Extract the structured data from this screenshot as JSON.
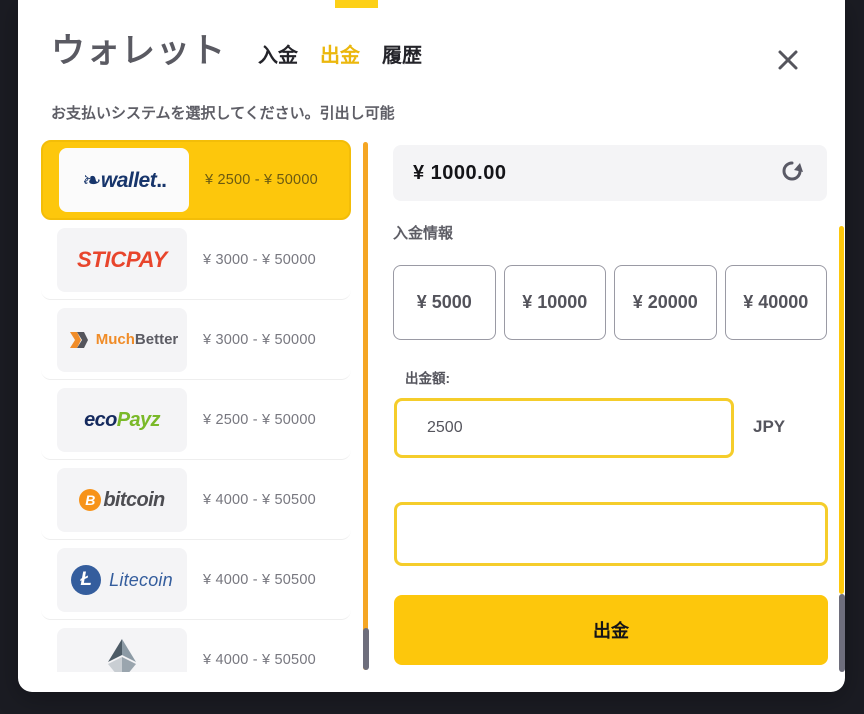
{
  "window": {
    "title": "ウォレット",
    "close_icon": "close-icon"
  },
  "tabs": [
    {
      "label": "入金",
      "active": false
    },
    {
      "label": "出金",
      "active": true
    },
    {
      "label": "履歴",
      "active": false
    }
  ],
  "subtitle": "お支払いシステムを選択してください。引出し可能",
  "payment_methods": [
    {
      "name": "iWallet",
      "logo": "iwallet-logo",
      "range": "¥ 2500 - ¥ 50000",
      "selected": true
    },
    {
      "name": "STICPAY",
      "logo": "sticpay-logo",
      "range": "¥ 3000 - ¥ 50000",
      "selected": false
    },
    {
      "name": "MuchBetter",
      "logo": "muchbetter-logo",
      "range": "¥ 3000 - ¥ 50000",
      "selected": false
    },
    {
      "name": "ecoPayz",
      "logo": "ecopayz-logo",
      "range": "¥ 2500 - ¥ 50000",
      "selected": false
    },
    {
      "name": "bitcoin",
      "logo": "bitcoin-logo",
      "range": "¥ 4000 - ¥ 50500",
      "selected": false
    },
    {
      "name": "Litecoin",
      "logo": "litecoin-logo",
      "range": "¥ 4000 - ¥ 50500",
      "selected": false
    },
    {
      "name": "Ethereum",
      "logo": "ethereum-logo",
      "range": "¥ 4000 - ¥ 50500",
      "selected": false
    }
  ],
  "balance": {
    "amount": "¥ 1000.00",
    "refresh_icon": "refresh-icon"
  },
  "deposit_info_label": "入金情報",
  "quick_amounts": [
    "¥ 5000",
    "¥ 10000",
    "¥ 20000",
    "¥ 40000"
  ],
  "amount_field": {
    "label": "出金額:",
    "value": "2500",
    "placeholder": "",
    "currency": "JPY"
  },
  "extra_field": {
    "value": "",
    "placeholder": ""
  },
  "submit": {
    "label": "出金"
  },
  "colors": {
    "accent_yellow": "#fdc70c",
    "active_tab": "#ebb70d",
    "input_border": "#f5cd2b",
    "scrollbar_thumb": "#6e6e7c",
    "page_background": "#1b1c23"
  }
}
